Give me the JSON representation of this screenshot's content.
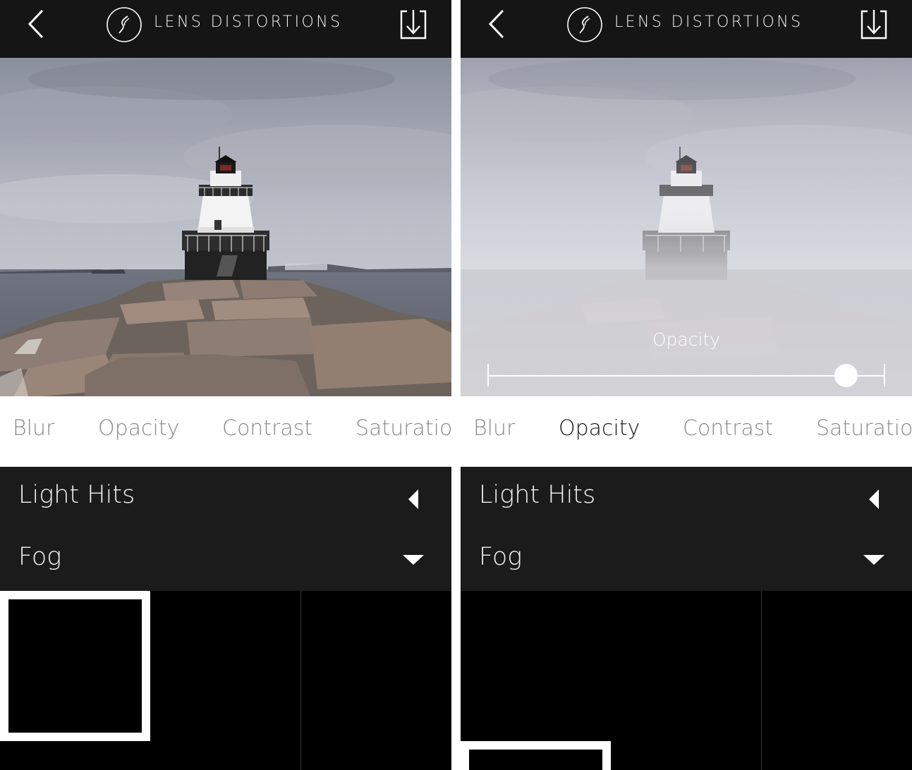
{
  "app": {
    "title": "LENS DISTORTIONS",
    "icons": {
      "back": "back-chevron-icon",
      "logo": "lens-distortions-logo-icon",
      "export": "export-download-icon"
    }
  },
  "panels": [
    {
      "id": "left",
      "tabs": [
        {
          "label": "Blur",
          "active": false
        },
        {
          "label": "Opacity",
          "active": false
        },
        {
          "label": "Contrast",
          "active": false
        },
        {
          "label": "Saturation",
          "active": false
        }
      ],
      "categories": [
        {
          "label": "Light Hits",
          "state": "collapsed",
          "icon": "triangle-left-icon"
        },
        {
          "label": "Fog",
          "state": "expanded",
          "icon": "triangle-down-icon"
        }
      ],
      "selected_thumbnail": 0
    },
    {
      "id": "right",
      "slider": {
        "label": "Opacity",
        "value": 0.9
      },
      "tabs": [
        {
          "label": "Blur",
          "active": false
        },
        {
          "label": "Opacity",
          "active": true
        },
        {
          "label": "Contrast",
          "active": false
        },
        {
          "label": "Saturation",
          "active": false
        }
      ],
      "categories": [
        {
          "label": "Light Hits",
          "state": "collapsed",
          "icon": "triangle-left-icon"
        },
        {
          "label": "Fog",
          "state": "expanded",
          "icon": "triangle-down-icon"
        }
      ],
      "selected_thumbnail": 3
    }
  ],
  "colors": {
    "bar_background": "#151515",
    "category_background": "#1b1b1b",
    "tab_inactive": "#8a8a8a",
    "tab_active": "#161616"
  }
}
